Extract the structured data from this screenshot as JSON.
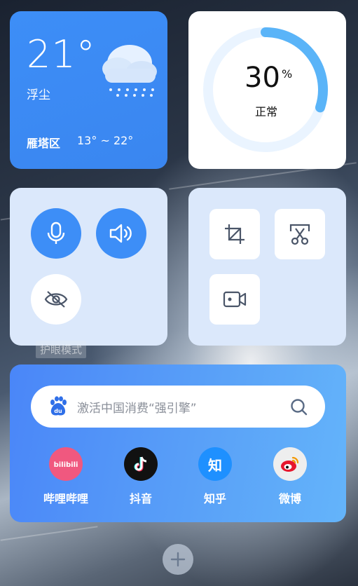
{
  "weather": {
    "temperature": "21°",
    "condition": "浮尘",
    "location": "雁塔区",
    "range": "13° ~ 22°",
    "icon": "cloud-snow-icon"
  },
  "gauge": {
    "value": "30",
    "unit": "%",
    "status": "正常",
    "percent": 30,
    "color": "#5ab4f8"
  },
  "toggles": {
    "microphone": {
      "icon": "microphone-icon",
      "active": true
    },
    "speaker": {
      "icon": "speaker-icon",
      "active": true
    },
    "eye_care": {
      "icon": "eye-off-icon",
      "active": false,
      "tooltip": "护眼模式"
    }
  },
  "tools": [
    {
      "icon": "crop-icon"
    },
    {
      "icon": "scissors-icon"
    },
    {
      "icon": "screen-record-icon"
    }
  ],
  "search": {
    "placeholder": "激活中国消费“强引擎”",
    "engine_icon": "baidu-icon",
    "search_icon": "search-icon"
  },
  "apps": [
    {
      "label": "哔哩哔哩",
      "icon": "bilibili-icon",
      "color": "#f0587f"
    },
    {
      "label": "抖音",
      "icon": "douyin-icon",
      "color": "#111111"
    },
    {
      "label": "知乎",
      "icon": "zhihu-icon",
      "color": "#1e90ff",
      "glyph": "知"
    },
    {
      "label": "微博",
      "icon": "weibo-icon",
      "color": "#eeeeee"
    }
  ],
  "add_button": {
    "icon": "plus-icon"
  }
}
